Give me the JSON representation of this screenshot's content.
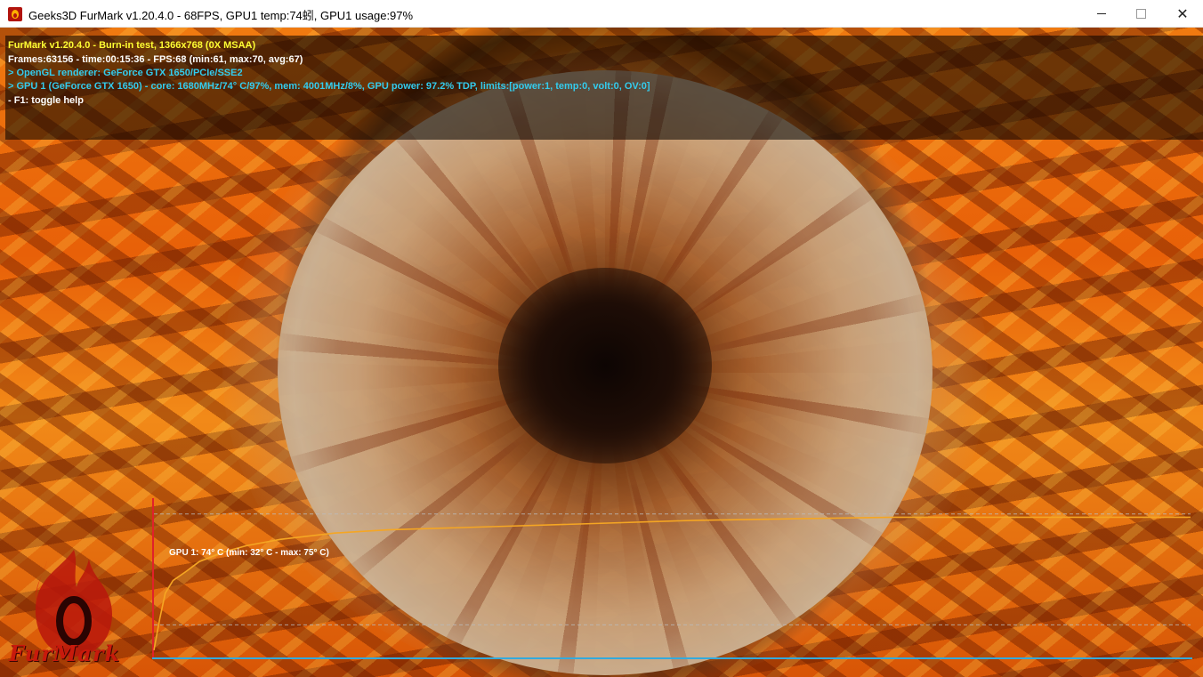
{
  "window": {
    "title": "Geeks3D FurMark v1.20.4.0 - 68FPS, GPU1 temp:74蚓, GPU1 usage:97%",
    "icon": "furmark-app-icon",
    "controls": {
      "minimize_icon": "minimize-icon",
      "maximize_icon": "maximize-icon",
      "close_icon": "close-icon",
      "close_glyph": "✕"
    }
  },
  "hud": {
    "line1": "FurMark v1.20.4.0 - Burn-in test, 1366x768 (0X MSAA)",
    "line2": "Frames:63156 - time:00:15:36 - FPS:68 (min:61, max:70, avg:67)",
    "line3": "> OpenGL renderer: GeForce GTX 1650/PCIe/SSE2",
    "line4": "> GPU 1 (GeForce GTX 1650) - core: 1680MHz/74° C/97%, mem: 4001MHz/8%, GPU power: 97.2% TDP, limits:[power:1, temp:0, volt:0, OV:0]",
    "line5": "- F1: toggle help",
    "colors": {
      "line1": "#ffff33",
      "line2": "#ffffff",
      "line3": "#33ccee",
      "line4": "#33ccee",
      "line5": "#ffffff"
    }
  },
  "chart_data": {
    "type": "line",
    "title": "GPU 1: 74° C (min: 32° C - max: 75° C)",
    "xlabel": "",
    "ylabel": "",
    "ylim": [
      30,
      80
    ],
    "grid": false,
    "series": [
      {
        "color": "#f5a623",
        "x": [
          0,
          0.2,
          0.5,
          1,
          2,
          3,
          5,
          7,
          10,
          15,
          20,
          30,
          40,
          50,
          60,
          70,
          80,
          90,
          100
        ],
        "values": [
          32,
          42,
          50,
          54,
          57,
          60,
          63,
          65,
          67,
          69,
          70,
          71,
          72,
          73,
          73.5,
          74,
          74,
          74,
          74
        ]
      }
    ],
    "reference_lines": [
      75,
      40
    ],
    "axis_colors": {
      "y": "#e0222a",
      "x": "#33aadd"
    }
  },
  "logo": {
    "text": "FurMark",
    "icon": "furmark-flame-logo-icon"
  }
}
